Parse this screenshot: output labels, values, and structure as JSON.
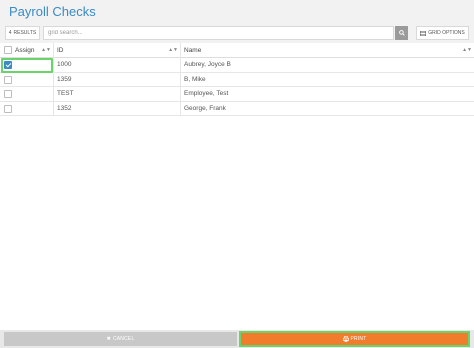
{
  "header": {
    "title": "Payroll Checks"
  },
  "toolbar": {
    "results_count": "4",
    "results_label": "RESULTS",
    "search_placeholder": "grid search...",
    "grid_options_label": "GRID OPTIONS"
  },
  "grid": {
    "columns": {
      "assign": "Assign",
      "id": "ID",
      "name": "Name"
    },
    "rows": [
      {
        "checked": true,
        "id": "1000",
        "name": "Aubrey, Joyce B"
      },
      {
        "checked": false,
        "id": "1359",
        "name": "B, Mike"
      },
      {
        "checked": false,
        "id": "TEST",
        "name": "Employee, Test"
      },
      {
        "checked": false,
        "id": "1352",
        "name": "George, Frank"
      }
    ]
  },
  "footer": {
    "cancel_label": "CANCEL",
    "print_label": "PRINT"
  },
  "colors": {
    "accent": "#3a8bc4",
    "print": "#f07c2c",
    "focus": "#6ad36a"
  }
}
